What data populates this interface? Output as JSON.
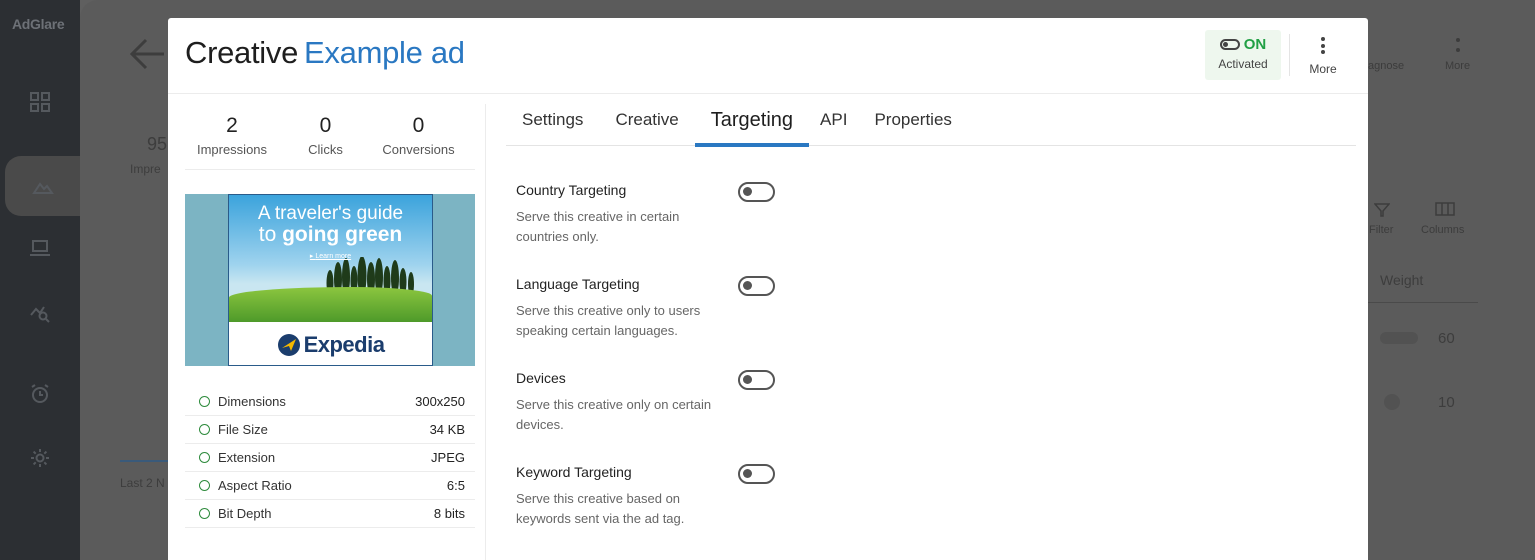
{
  "background": {
    "logo": "AdGlare",
    "stat_partial": "95",
    "stat_label_partial": "Impre",
    "footer_partial": "Last 2 N",
    "right_buttons": [
      {
        "label": "agnose"
      },
      {
        "label": "More"
      },
      {
        "label": "Filter"
      },
      {
        "label": "Columns"
      }
    ],
    "table_header": "Weight",
    "table_values": [
      "60",
      "10"
    ]
  },
  "modal": {
    "title_prefix": "Creative",
    "title_name": "Example ad",
    "status": {
      "state": "ON",
      "label": "Activated",
      "color": "#21a045"
    },
    "more_label": "More",
    "stats": [
      {
        "value": "2",
        "label": "Impressions"
      },
      {
        "value": "0",
        "label": "Clicks"
      },
      {
        "value": "0",
        "label": "Conversions"
      }
    ],
    "ad_preview": {
      "headline_line1": "A traveler's guide",
      "headline_line2_pre": "to ",
      "headline_line2_bold": "going green",
      "cta": "Learn more",
      "brand": "Expedia"
    },
    "properties": [
      {
        "label": "Dimensions",
        "value": "300x250"
      },
      {
        "label": "File Size",
        "value": "34 KB"
      },
      {
        "label": "Extension",
        "value": "JPEG"
      },
      {
        "label": "Aspect Ratio",
        "value": "6:5"
      },
      {
        "label": "Bit Depth",
        "value": "8 bits"
      }
    ],
    "tabs": [
      {
        "label": "Settings",
        "active": false
      },
      {
        "label": "Creative",
        "active": false
      },
      {
        "label": "Targeting",
        "active": true
      },
      {
        "label": "API",
        "active": false
      },
      {
        "label": "Properties",
        "active": false
      }
    ],
    "targeting": [
      {
        "title": "Country Targeting",
        "description": "Serve this creative in certain countries only.",
        "enabled": false
      },
      {
        "title": "Language Targeting",
        "description": "Serve this creative only to users speaking certain languages.",
        "enabled": false
      },
      {
        "title": "Devices",
        "description": "Serve this creative only on certain devices.",
        "enabled": false
      },
      {
        "title": "Keyword Targeting",
        "description": "Serve this creative based on keywords sent via the ad tag.",
        "enabled": false
      }
    ],
    "accent_color": "#2a78c2"
  }
}
